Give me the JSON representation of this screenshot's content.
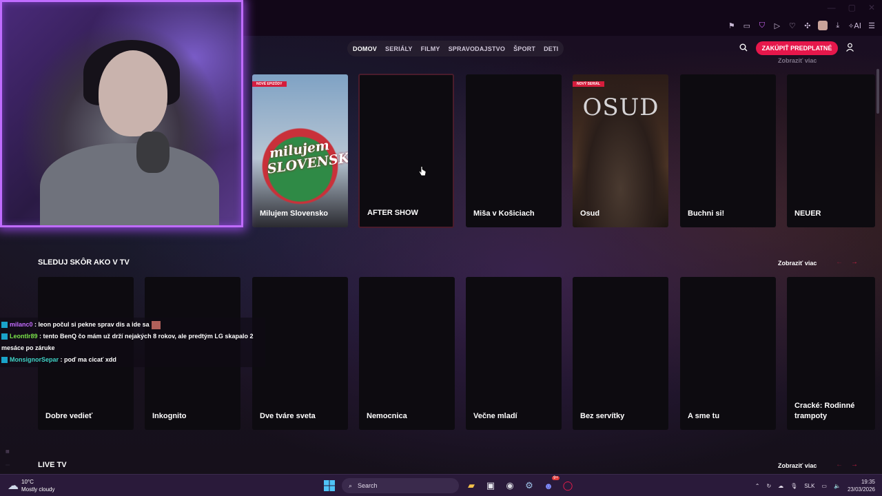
{
  "browser": {
    "extensions": [
      "bookmark-icon",
      "tab-icon",
      "shield-icon",
      "play-icon",
      "heart-icon",
      "extension-icon",
      "avatar",
      "download-icon",
      "ai-icon",
      "menu-icon"
    ],
    "ai_label": "AI"
  },
  "site_nav": {
    "items": [
      "DOMOV",
      "SERIÁLY",
      "FILMY",
      "SPRAVODAJSTVO",
      "ŠPORT",
      "DETI"
    ],
    "active": "DOMOV",
    "cta_label": "ZAKÚPIŤ PREDPLATNÉ"
  },
  "top_row": {
    "more_label": "Zobraziť viac",
    "cards": [
      {
        "title": "Milujem Slovensko",
        "badge": "NOVÉ EPIZÓDY",
        "poster_text": "milujem SLOVENSKO"
      },
      {
        "title": "AFTER SHOW"
      },
      {
        "title": "Miša v Košiciach"
      },
      {
        "title": "Osud",
        "badge": "NOVÝ SERIÁL",
        "poster_text": "OSUD"
      },
      {
        "title": "Buchni si!"
      },
      {
        "title": "NEUER"
      }
    ]
  },
  "tv_row": {
    "heading": "SLEDUJ SKÔR AKO V TV",
    "more_label": "Zobraziť viac",
    "cards": [
      {
        "title": "Dobre vedieť"
      },
      {
        "title": "Inkognito"
      },
      {
        "title": "Dve tváre sveta"
      },
      {
        "title": "Nemocnica"
      },
      {
        "title": "Večne mladí"
      },
      {
        "title": "Bez servítky"
      },
      {
        "title": "A sme tu"
      },
      {
        "title": "Cracké: Rodinné trampoty"
      }
    ]
  },
  "live_row": {
    "heading": "LIVE TV",
    "more_label": "Zobraziť viac"
  },
  "chat": [
    {
      "user": "milanc0",
      "message": ": leon počul si pekne sprav dis a ide sa",
      "has_emote": true
    },
    {
      "user": "Leontlr89",
      "message": ": tento BenQ čo mám už drží nejakých 8 rokov, ale predtým LG skapalo 2 mesáce po záruke"
    },
    {
      "user": "MonsignorSepar",
      "message": ": poď ma cicať xdd"
    }
  ],
  "taskbar": {
    "temperature": "10°C",
    "weather": "Mostly cloudy",
    "search_placeholder": "Search",
    "language": "SLK",
    "time": "19:35",
    "date": "23/03/2026",
    "discord_badge": "9+"
  },
  "colors": {
    "accent": "#e6174b",
    "webcam_glow": "#c06cff"
  }
}
